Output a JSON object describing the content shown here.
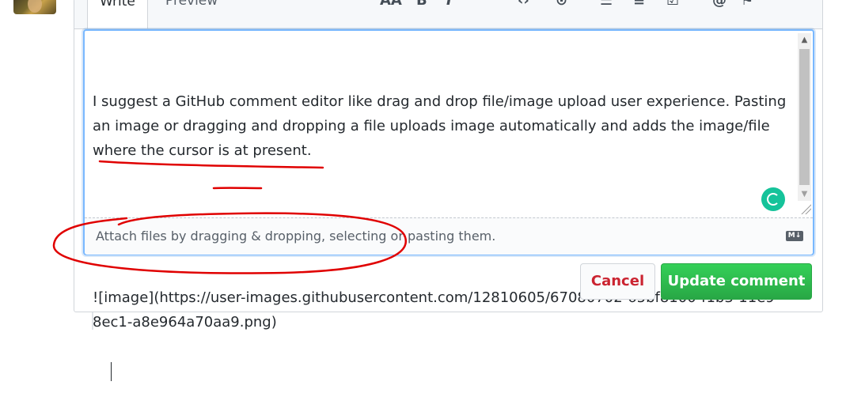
{
  "tabs": [
    {
      "label": "Write",
      "active": true
    },
    {
      "label": "Preview",
      "active": false
    }
  ],
  "toolbar": [
    {
      "icon": "text-size-icon",
      "glyph": "AA"
    },
    {
      "icon": "bold-icon",
      "glyph": "B"
    },
    {
      "icon": "italic-icon",
      "glyph": "I"
    },
    {
      "icon": "quote-icon",
      "glyph": "❝"
    },
    {
      "icon": "code-icon",
      "glyph": "‹›"
    },
    {
      "icon": "link-icon",
      "glyph": "⊙"
    },
    {
      "icon": "bullet-list-icon",
      "glyph": "☰"
    },
    {
      "icon": "numbered-list-icon",
      "glyph": "≡"
    },
    {
      "icon": "task-list-icon",
      "glyph": "☑"
    },
    {
      "icon": "mention-icon",
      "glyph": "@"
    },
    {
      "icon": "bookmark-icon",
      "glyph": "⚑"
    }
  ],
  "editor": {
    "paragraph": "I suggest a GitHub comment editor like drag and drop file/image upload user experience. Pasting an image or dragging and dropping a file uploads image automatically and adds the image/file where the cursor is at present.",
    "image_markdown": "![image](https://user-images.githubusercontent.com/12810605/67080702-65bf8100-f1b3-11e9-8ec1-a8e964a70aa9.png)"
  },
  "dropzone": {
    "text": "Attach files by dragging & dropping, selecting or pasting them.",
    "markdown_badge": "M↓"
  },
  "buttons": {
    "cancel": "Cancel",
    "update": "Update comment"
  },
  "colors": {
    "annotation": "#e00000",
    "primary": "#2ea44f",
    "danger": "#cb2431",
    "focus": "#79b8ff"
  }
}
